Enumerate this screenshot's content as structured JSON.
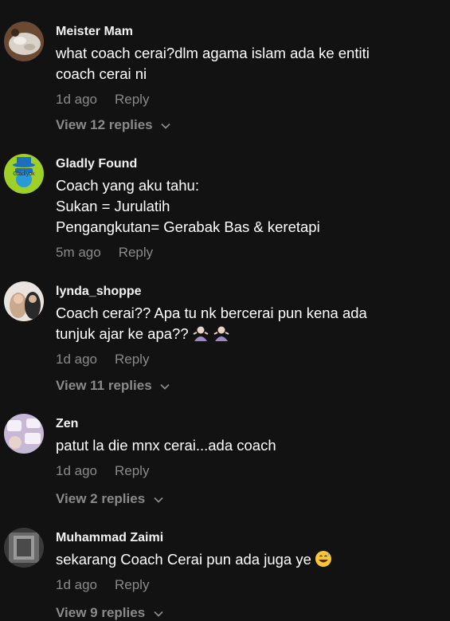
{
  "comments": [
    {
      "username": "Meister Mam",
      "lines": [
        "what coach cerai?dlm agama islam ada ke entiti",
        "coach cerai ni"
      ],
      "time": "1d ago",
      "reply": "Reply",
      "view_replies": "View 12 replies",
      "avatar_icon": "food-photo-avatar"
    },
    {
      "username": "Gladly Found",
      "lines": [
        "Coach yang aku tahu:",
        "Sukan = Jurulatih",
        "Pengangkutan= Gerabak Bas & keretapi"
      ],
      "time": "5m ago",
      "reply": "Reply",
      "avatar_icon": "cartoon-avatar",
      "avatar_text": "Gladlyok"
    },
    {
      "username": "lynda_shoppe",
      "lines": [
        "Coach cerai?? Apa tu nk bercerai pun kena ada",
        "tunjuk ajar ke apa??"
      ],
      "emoji": "person-shrugging",
      "time": "1d ago",
      "reply": "Reply",
      "view_replies": "View 11 replies",
      "avatar_icon": "hijab-woman-avatar"
    },
    {
      "username": "Zen",
      "lines": [
        "patut la die mnx cerai...ada coach"
      ],
      "time": "1d ago",
      "reply": "Reply",
      "view_replies": "View 2 replies",
      "avatar_icon": "comic-avatar"
    },
    {
      "username": "Muhammad Zaimi",
      "lines": [
        "sekarang Coach Cerai pun ada juga ye"
      ],
      "emoji": "grinning-sweat",
      "time": "1d ago",
      "reply": "Reply",
      "view_replies": "View 9 replies",
      "avatar_icon": "gray-avatar"
    }
  ],
  "colors": {
    "background": "#121212",
    "primary_text": "#ffffff",
    "secondary_text": "#8a8a8a"
  }
}
